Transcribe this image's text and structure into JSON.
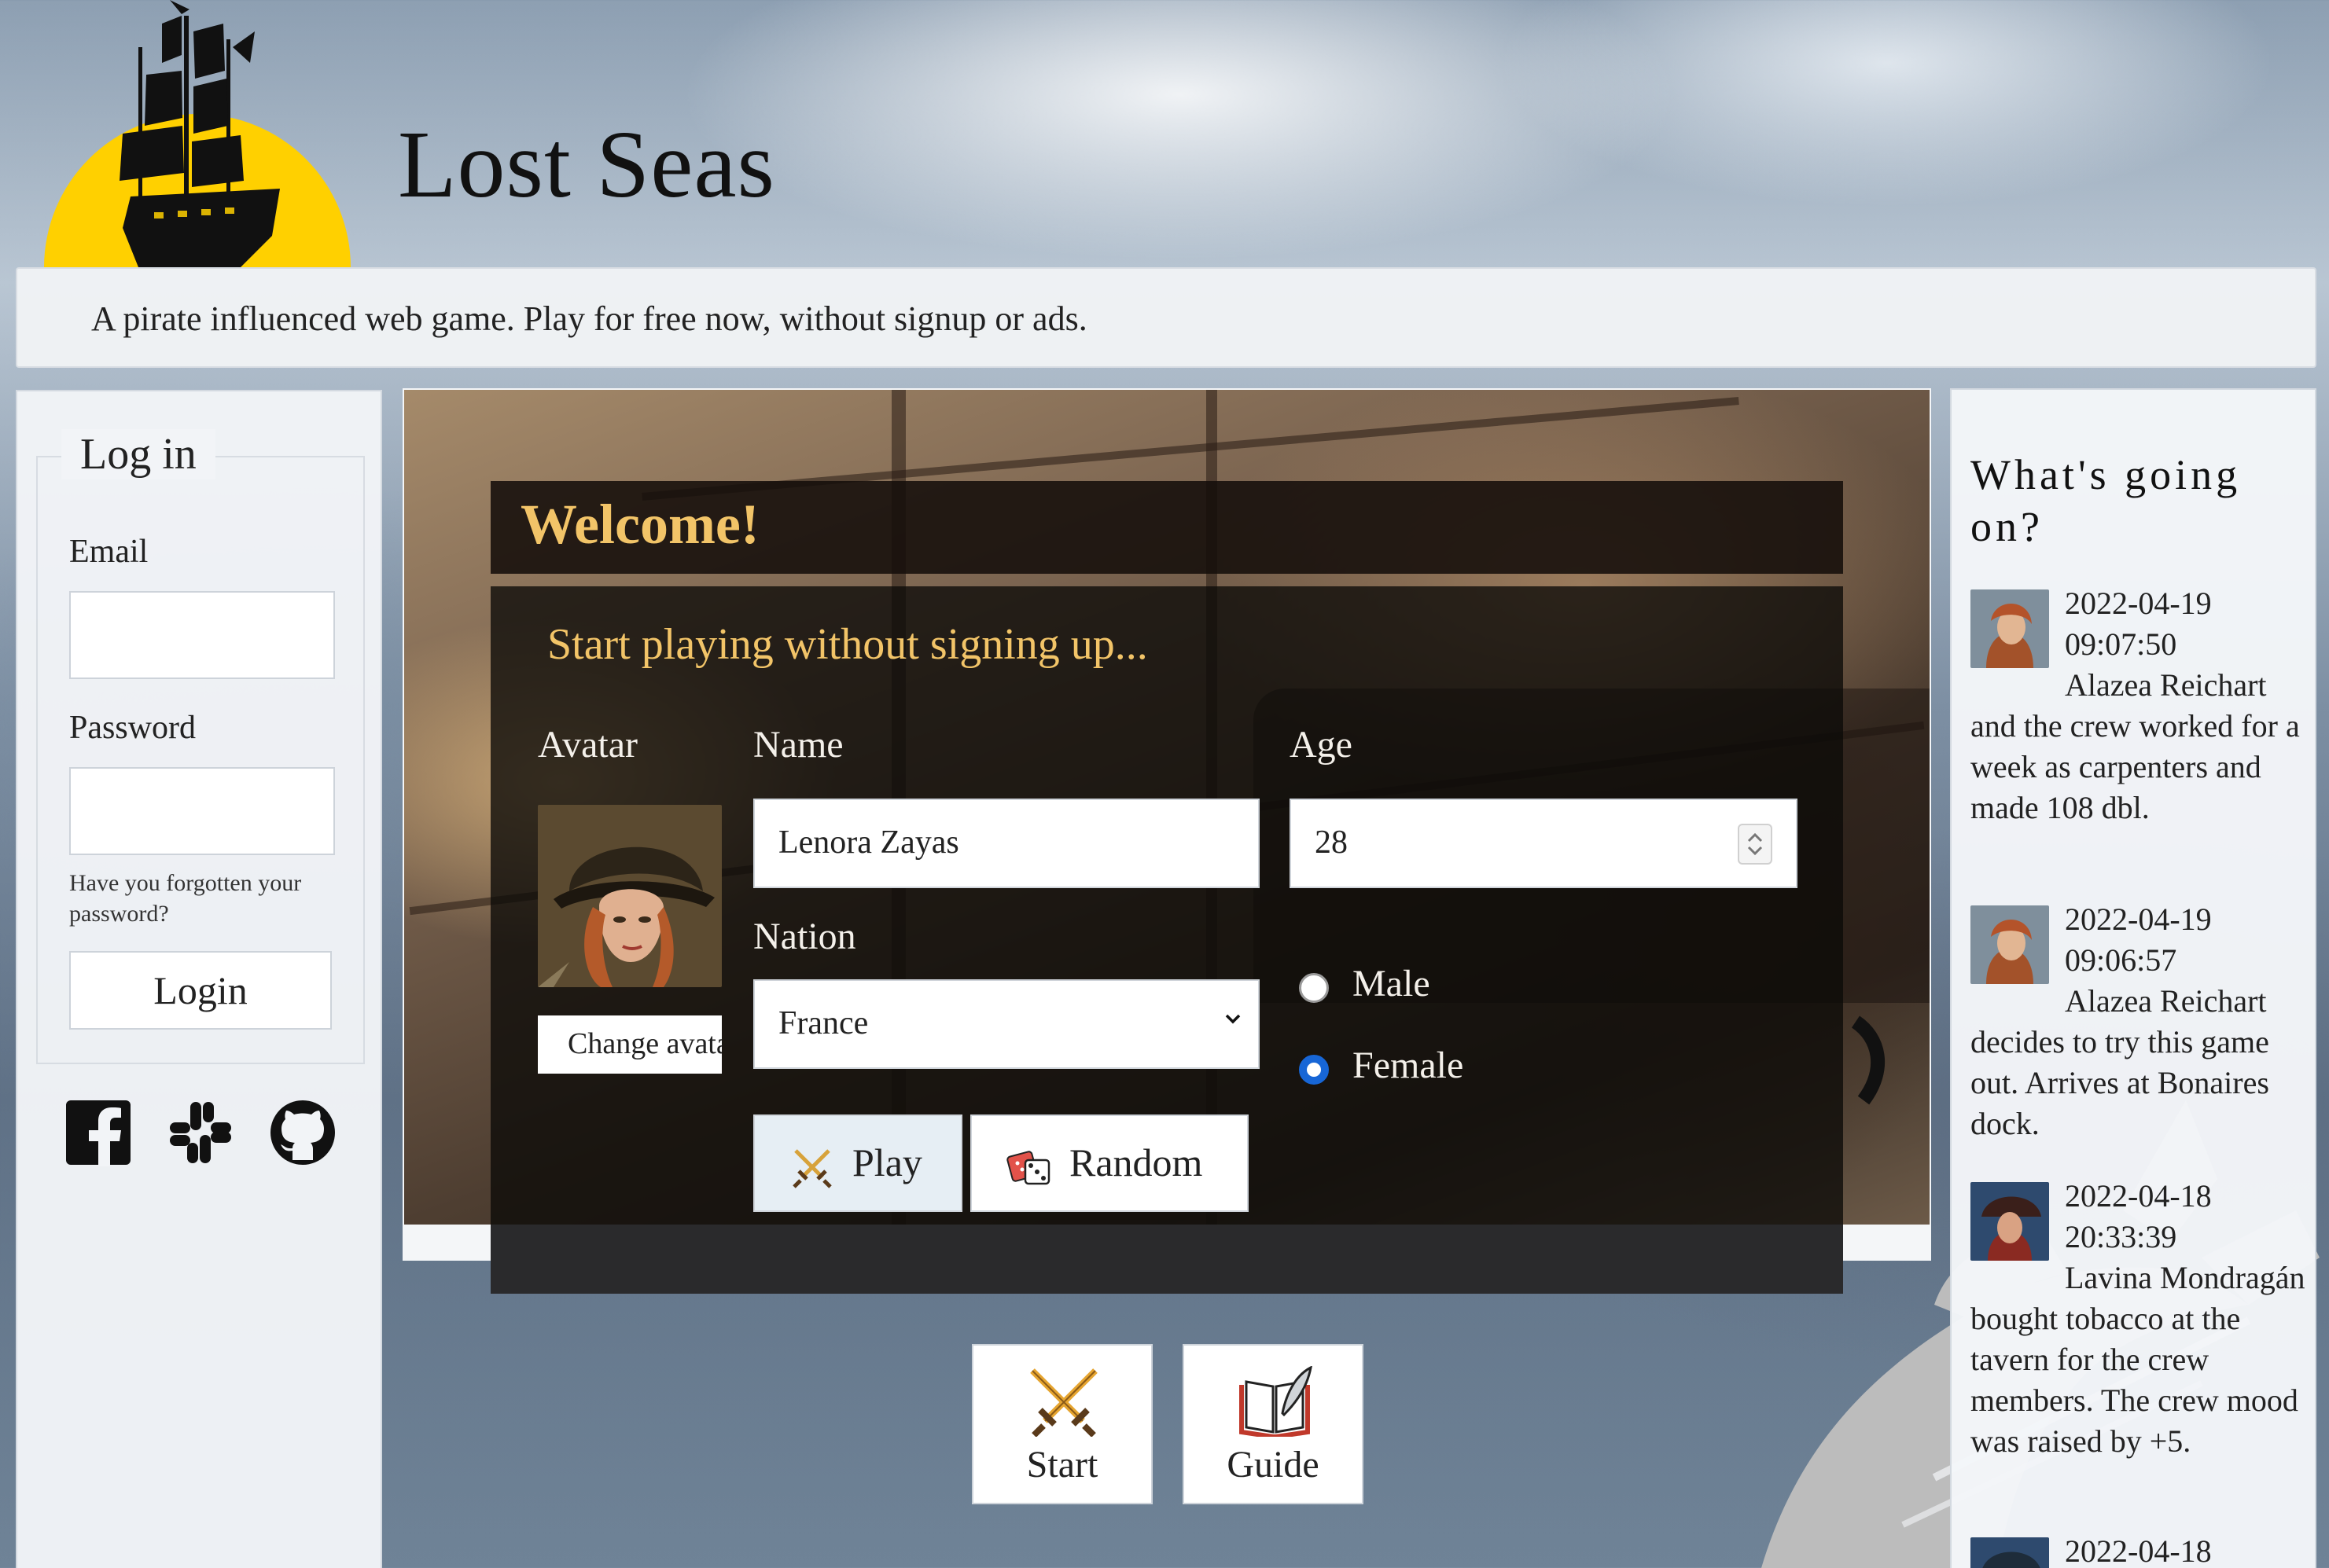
{
  "header": {
    "site_title": "Lost Seas",
    "tagline": "A pirate influenced web game. Play for free now, without signup or ads."
  },
  "login": {
    "legend": "Log in",
    "email_label": "Email",
    "email_value": "",
    "password_label": "Password",
    "password_value": "",
    "forgot_text": "Have you forgotten your password?",
    "login_button": "Login",
    "social_icons": [
      "facebook-icon",
      "slack-icon",
      "github-icon"
    ]
  },
  "welcome": {
    "title": "Welcome!",
    "heading": "Start playing without signing up...",
    "avatar_label": "Avatar",
    "change_avatar": "Change avatar",
    "name_label": "Name",
    "name_value": "Lenora Zayas",
    "age_label": "Age",
    "age_value": "28",
    "nation_label": "Nation",
    "nation_value": "France",
    "gender_male": "Male",
    "gender_female": "Female",
    "gender_selected": "Female",
    "play_button": "Play",
    "random_button": "Random"
  },
  "tiles": {
    "start": "Start",
    "guide": "Guide"
  },
  "news": {
    "title": "What's going on?",
    "items": [
      {
        "date": "2022-04-19",
        "time": "09:07:50",
        "text": "Alazea Reichart and the crew worked for a week as carpenters and made 108 dbl."
      },
      {
        "date": "2022-04-19",
        "time": "09:06:57",
        "text": "Alazea Reichart decides to try this game out. Arrives at Bonaires dock."
      },
      {
        "date": "2022-04-18",
        "time": "20:33:39",
        "text": "Lavina Mondragán bought tobacco at the tavern for the crew members. The crew mood was raised by +5."
      },
      {
        "date": "2022-04-18",
        "time": "",
        "text": ""
      }
    ]
  },
  "colors": {
    "accent_gold": "#f2c468",
    "sun_yellow": "#ffd000",
    "radio_blue": "#1766d6"
  }
}
